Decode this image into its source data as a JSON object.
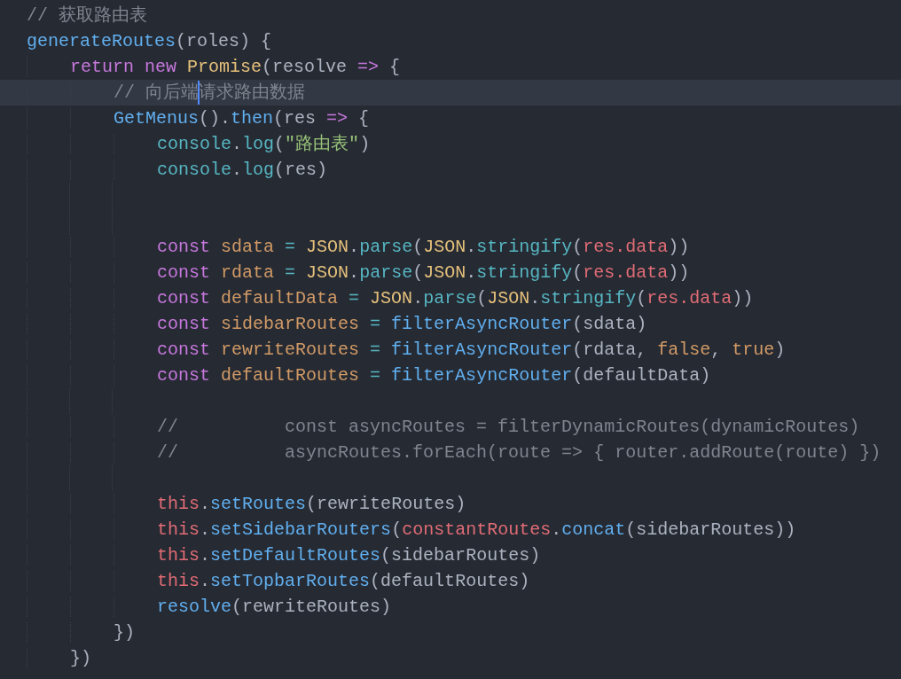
{
  "editor": {
    "lines": [
      {
        "current": false,
        "tokens": [
          {
            "kind": "comment",
            "text": "// 获取路由表"
          }
        ]
      },
      {
        "current": false,
        "tokens": [
          {
            "kind": "function",
            "text": "generateRoutes"
          },
          {
            "kind": "plain",
            "text": "(roles) {"
          }
        ]
      },
      {
        "current": false,
        "tokens": [
          {
            "kind": "keyword",
            "text": "    return new "
          },
          {
            "kind": "class",
            "text": "Promise"
          },
          {
            "kind": "plain",
            "text": "(resolve "
          },
          {
            "kind": "keyword",
            "text": "=>"
          },
          {
            "kind": "plain",
            "text": " {"
          }
        ]
      },
      {
        "current": true,
        "tokens": [
          {
            "kind": "comment",
            "text": "        // 向后端"
          },
          {
            "kind": "caret"
          },
          {
            "kind": "comment",
            "text": "请求路由数据"
          }
        ]
      },
      {
        "current": false,
        "tokens": [
          {
            "kind": "function",
            "text": "        GetMenus"
          },
          {
            "kind": "plain",
            "text": "()."
          },
          {
            "kind": "function",
            "text": "then"
          },
          {
            "kind": "plain",
            "text": "(res "
          },
          {
            "kind": "keyword",
            "text": "=>"
          },
          {
            "kind": "plain",
            "text": " {"
          }
        ]
      },
      {
        "current": false,
        "tokens": [
          {
            "kind": "method",
            "text": "            console"
          },
          {
            "kind": "plain",
            "text": "."
          },
          {
            "kind": "method",
            "text": "log"
          },
          {
            "kind": "plain",
            "text": "("
          },
          {
            "kind": "string",
            "text": "\"路由表\""
          },
          {
            "kind": "plain",
            "text": ")"
          }
        ]
      },
      {
        "current": false,
        "tokens": [
          {
            "kind": "method",
            "text": "            console"
          },
          {
            "kind": "plain",
            "text": "."
          },
          {
            "kind": "method",
            "text": "log"
          },
          {
            "kind": "plain",
            "text": "(res)"
          }
        ]
      },
      {
        "current": false
      },
      {
        "current": false
      },
      {
        "current": false,
        "tokens": [
          {
            "kind": "keyword",
            "text": "            const "
          },
          {
            "kind": "variable",
            "text": "sdata"
          },
          {
            "kind": "operator",
            "text": " = "
          },
          {
            "kind": "class",
            "text": "JSON"
          },
          {
            "kind": "plain",
            "text": "."
          },
          {
            "kind": "method",
            "text": "parse"
          },
          {
            "kind": "plain",
            "text": "("
          },
          {
            "kind": "class",
            "text": "JSON"
          },
          {
            "kind": "plain",
            "text": "."
          },
          {
            "kind": "method",
            "text": "stringify"
          },
          {
            "kind": "plain",
            "text": "("
          },
          {
            "kind": "red",
            "text": "res.data"
          },
          {
            "kind": "plain",
            "text": "))"
          }
        ]
      },
      {
        "current": false,
        "tokens": [
          {
            "kind": "keyword",
            "text": "            const "
          },
          {
            "kind": "variable",
            "text": "rdata"
          },
          {
            "kind": "operator",
            "text": " = "
          },
          {
            "kind": "class",
            "text": "JSON"
          },
          {
            "kind": "plain",
            "text": "."
          },
          {
            "kind": "method",
            "text": "parse"
          },
          {
            "kind": "plain",
            "text": "("
          },
          {
            "kind": "class",
            "text": "JSON"
          },
          {
            "kind": "plain",
            "text": "."
          },
          {
            "kind": "method",
            "text": "stringify"
          },
          {
            "kind": "plain",
            "text": "("
          },
          {
            "kind": "red",
            "text": "res.data"
          },
          {
            "kind": "plain",
            "text": "))"
          }
        ]
      },
      {
        "current": false,
        "tokens": [
          {
            "kind": "keyword",
            "text": "            const "
          },
          {
            "kind": "variable",
            "text": "defaultData"
          },
          {
            "kind": "operator",
            "text": " = "
          },
          {
            "kind": "class",
            "text": "JSON"
          },
          {
            "kind": "plain",
            "text": "."
          },
          {
            "kind": "method",
            "text": "parse"
          },
          {
            "kind": "plain",
            "text": "("
          },
          {
            "kind": "class",
            "text": "JSON"
          },
          {
            "kind": "plain",
            "text": "."
          },
          {
            "kind": "method",
            "text": "stringify"
          },
          {
            "kind": "plain",
            "text": "("
          },
          {
            "kind": "red",
            "text": "res.data"
          },
          {
            "kind": "plain",
            "text": "))"
          }
        ]
      },
      {
        "current": false,
        "tokens": [
          {
            "kind": "keyword",
            "text": "            const "
          },
          {
            "kind": "variable",
            "text": "sidebarRoutes"
          },
          {
            "kind": "operator",
            "text": " = "
          },
          {
            "kind": "function",
            "text": "filterAsyncRouter"
          },
          {
            "kind": "plain",
            "text": "(sdata)"
          }
        ]
      },
      {
        "current": false,
        "tokens": [
          {
            "kind": "keyword",
            "text": "            const "
          },
          {
            "kind": "variable",
            "text": "rewriteRoutes"
          },
          {
            "kind": "operator",
            "text": " = "
          },
          {
            "kind": "function",
            "text": "filterAsyncRouter"
          },
          {
            "kind": "plain",
            "text": "(rdata, "
          },
          {
            "kind": "variable",
            "text": "false"
          },
          {
            "kind": "plain",
            "text": ", "
          },
          {
            "kind": "variable",
            "text": "true"
          },
          {
            "kind": "plain",
            "text": ")"
          }
        ]
      },
      {
        "current": false,
        "tokens": [
          {
            "kind": "keyword",
            "text": "            const "
          },
          {
            "kind": "variable",
            "text": "defaultRoutes"
          },
          {
            "kind": "operator",
            "text": " = "
          },
          {
            "kind": "function",
            "text": "filterAsyncRouter"
          },
          {
            "kind": "plain",
            "text": "(defaultData)"
          }
        ]
      },
      {
        "current": false
      },
      {
        "current": false,
        "tokens": [
          {
            "kind": "comment",
            "text": "            //          const asyncRoutes = filterDynamicRoutes(dynamicRoutes)"
          }
        ]
      },
      {
        "current": false,
        "tokens": [
          {
            "kind": "comment",
            "text": "            //          asyncRoutes.forEach(route => { router.addRoute(route) })"
          }
        ]
      },
      {
        "current": false
      },
      {
        "current": false,
        "tokens": [
          {
            "kind": "red",
            "text": "            this"
          },
          {
            "kind": "plain",
            "text": "."
          },
          {
            "kind": "function",
            "text": "setRoutes"
          },
          {
            "kind": "plain",
            "text": "(rewriteRoutes)"
          }
        ]
      },
      {
        "current": false,
        "tokens": [
          {
            "kind": "red",
            "text": "            this"
          },
          {
            "kind": "plain",
            "text": "."
          },
          {
            "kind": "function",
            "text": "setSidebarRouters"
          },
          {
            "kind": "plain",
            "text": "("
          },
          {
            "kind": "red",
            "text": "constantRoutes"
          },
          {
            "kind": "plain",
            "text": "."
          },
          {
            "kind": "function",
            "text": "concat"
          },
          {
            "kind": "plain",
            "text": "(sidebarRoutes))"
          }
        ]
      },
      {
        "current": false,
        "tokens": [
          {
            "kind": "red",
            "text": "            this"
          },
          {
            "kind": "plain",
            "text": "."
          },
          {
            "kind": "function",
            "text": "setDefaultRoutes"
          },
          {
            "kind": "plain",
            "text": "(sidebarRoutes)"
          }
        ]
      },
      {
        "current": false,
        "tokens": [
          {
            "kind": "red",
            "text": "            this"
          },
          {
            "kind": "plain",
            "text": "."
          },
          {
            "kind": "function",
            "text": "setTopbarRoutes"
          },
          {
            "kind": "plain",
            "text": "(defaultRoutes)"
          }
        ]
      },
      {
        "current": false,
        "tokens": [
          {
            "kind": "function",
            "text": "            resolve"
          },
          {
            "kind": "plain",
            "text": "(rewriteRoutes)"
          }
        ]
      },
      {
        "current": false,
        "tokens": [
          {
            "kind": "plain",
            "text": "        })"
          }
        ]
      },
      {
        "current": false,
        "tokens": [
          {
            "kind": "plain",
            "text": "    })"
          }
        ]
      }
    ]
  }
}
